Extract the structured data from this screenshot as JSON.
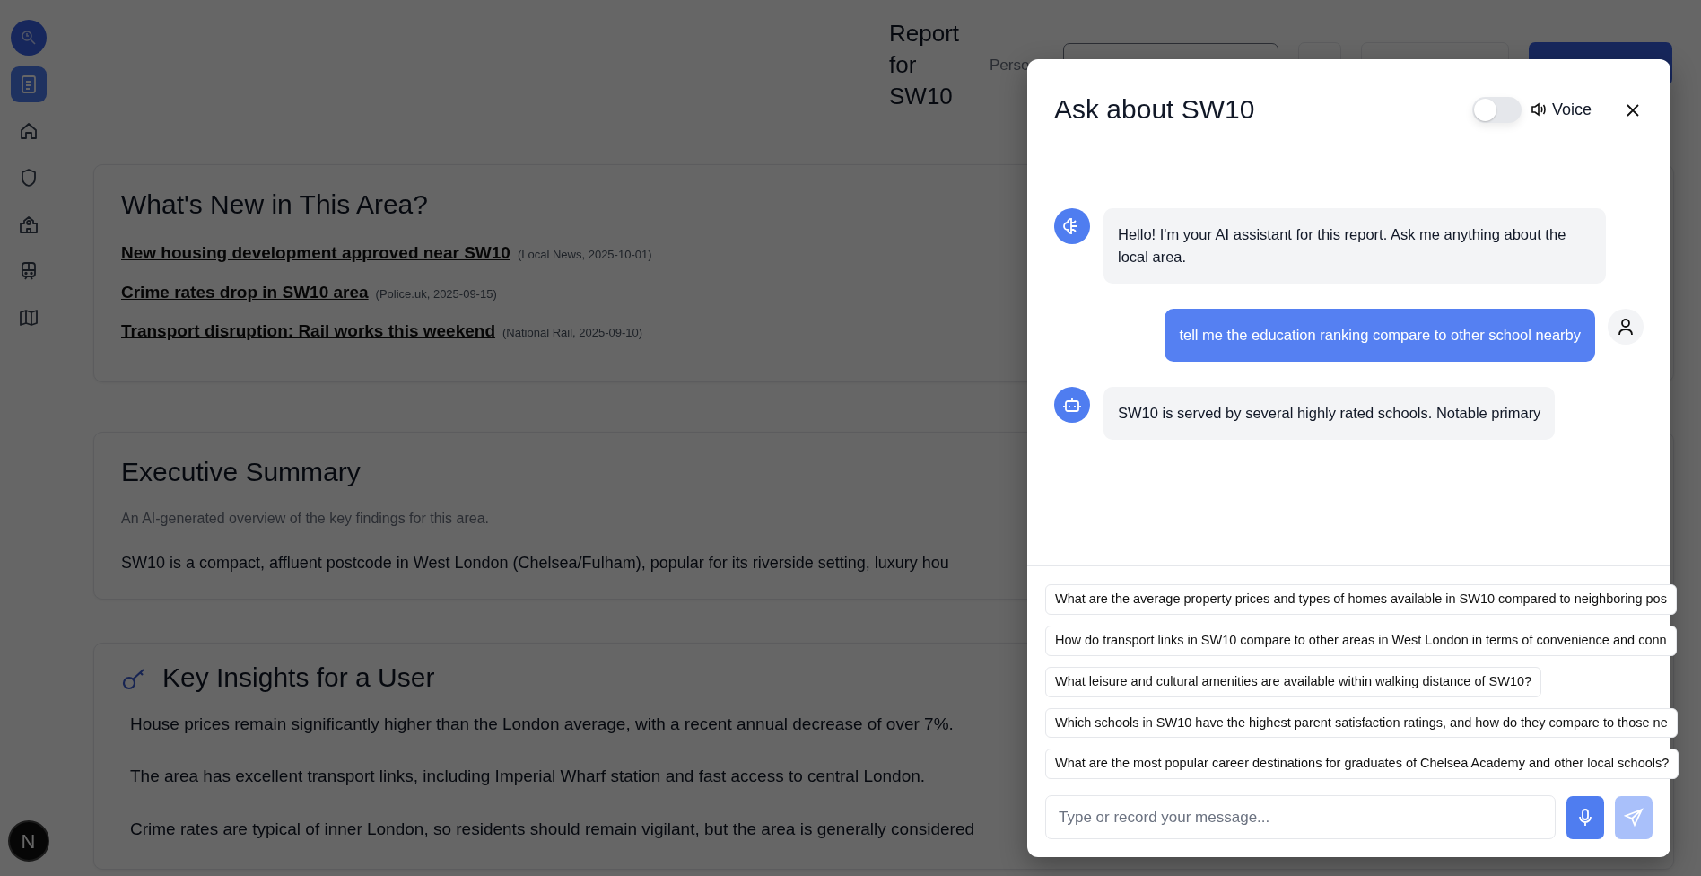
{
  "sidebar": {
    "items": [
      {
        "kind": "report",
        "selected": true
      },
      {
        "kind": "home",
        "selected": false
      },
      {
        "kind": "shield",
        "selected": false
      },
      {
        "kind": "school",
        "selected": false
      },
      {
        "kind": "train",
        "selected": false
      },
      {
        "kind": "map",
        "selected": false
      }
    ],
    "dev_badge": "N"
  },
  "header": {
    "title": "Report for SW10",
    "persona_label": "Perso"
  },
  "news": {
    "title": "What's New in This Area?",
    "items": [
      {
        "title": "New housing development approved near SW10",
        "source": "(Local News, 2025-10-01)"
      },
      {
        "title": "Crime rates drop in SW10 area",
        "source": "(Police.uk, 2025-09-15)"
      },
      {
        "title": "Transport disruption: Rail works this weekend",
        "source": "(National Rail, 2025-09-10)"
      }
    ]
  },
  "summary": {
    "title": "Executive Summary",
    "subtitle": "An AI-generated overview of the key findings for this area.",
    "text": "SW10 is a compact, affluent postcode in West London (Chelsea/Fulham), popular for its riverside setting, luxury hou"
  },
  "insights": {
    "title": "Key Insights for a User",
    "items": [
      "House prices remain significantly higher than the London average, with a recent annual decrease of over 7%.",
      "The area has excellent transport links, including Imperial Wharf station and fast access to central London.",
      "Crime rates are typical of inner London, so residents should remain vigilant, but the area is generally considered"
    ]
  },
  "chat": {
    "title": "Ask about SW10",
    "voice_label": "Voice",
    "voice_on": false,
    "messages": [
      {
        "kind": "brain",
        "text": "Hello! I'm your AI assistant for this report. Ask me anything about the local area."
      },
      {
        "kind": "person",
        "text": "tell me the education ranking compare to other school nearby"
      },
      {
        "kind": "robot",
        "text": "SW10 is served by several highly rated schools. Notable primary"
      }
    ],
    "suggestions": [
      "What are the average property prices and types of homes available in SW10 compared to neighboring pos",
      "How do transport links in SW10 compare to other areas in West London in terms of convenience and conn",
      "What leisure and cultural amenities are available within walking distance of SW10?",
      "Which schools in SW10 have the highest parent satisfaction ratings, and how do they compare to those ne",
      "What are the most popular career destinations for graduates of Chelsea Academy and other local schools?"
    ],
    "input": {
      "placeholder": "Type or record your message..."
    },
    "send_disabled": true
  }
}
